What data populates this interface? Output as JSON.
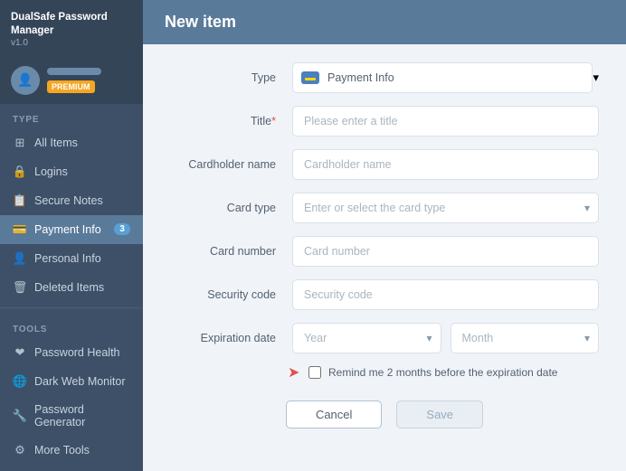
{
  "app": {
    "name": "DualSafe Password Manager",
    "version": "v1.0",
    "premium_label": "PREMIUM"
  },
  "sidebar": {
    "type_label": "TYPE",
    "tools_label": "TOOLS",
    "items": [
      {
        "id": "all-items",
        "label": "All Items",
        "icon": "⊞"
      },
      {
        "id": "logins",
        "label": "Logins",
        "icon": "🔒"
      },
      {
        "id": "secure-notes",
        "label": "Secure Notes",
        "icon": "📋"
      },
      {
        "id": "payment-info",
        "label": "Payment Info",
        "icon": "💳",
        "badge": "3",
        "active": true
      },
      {
        "id": "personal-info",
        "label": "Personal Info",
        "icon": "👤"
      },
      {
        "id": "deleted-items",
        "label": "Deleted Items",
        "icon": "🗑"
      }
    ],
    "tools": [
      {
        "id": "password-health",
        "label": "Password Health",
        "icon": "❤"
      },
      {
        "id": "dark-web-monitor",
        "label": "Dark Web Monitor",
        "icon": "🌐"
      },
      {
        "id": "password-generator",
        "label": "Password Generator",
        "icon": "🔧"
      },
      {
        "id": "more-tools",
        "label": "More Tools",
        "icon": "⚙"
      }
    ]
  },
  "main": {
    "title": "New item",
    "form": {
      "type_label": "Type",
      "type_value": "Payment Info",
      "title_label": "Title",
      "title_required": "*",
      "title_placeholder": "Please enter a title",
      "cardholder_label": "Cardholder name",
      "cardholder_placeholder": "Cardholder name",
      "card_type_label": "Card type",
      "card_type_placeholder": "Enter or select the card type",
      "card_number_label": "Card number",
      "card_number_placeholder": "Card number",
      "security_code_label": "Security code",
      "security_code_placeholder": "Security code",
      "expiration_label": "Expiration date",
      "year_placeholder": "Year",
      "month_placeholder": "Month",
      "reminder_text": "Remind me 2 months before the expiration date",
      "cancel_label": "Cancel",
      "save_label": "Save"
    }
  }
}
